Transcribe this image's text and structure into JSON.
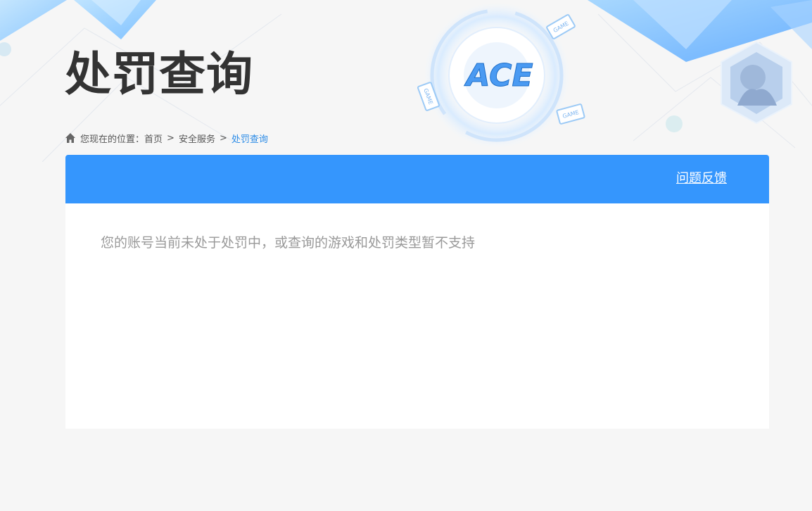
{
  "header": {
    "title": "处罚查询",
    "logo_text": "ACE",
    "badge_text": "GAME"
  },
  "breadcrumb": {
    "prefix": "您现在的位置：",
    "items": [
      "首页",
      "安全服务"
    ],
    "current": "处罚查询",
    "separator": ">"
  },
  "panel": {
    "feedback_label": "问题反馈",
    "message": "您的账号当前未处于处罚中，或查询的游戏和处罚类型暂不支持"
  },
  "colors": {
    "accent": "#3596fd",
    "breadcrumb_current": "#2b8be6",
    "title": "#333333",
    "message": "#999999",
    "background": "#f6f6f6"
  }
}
